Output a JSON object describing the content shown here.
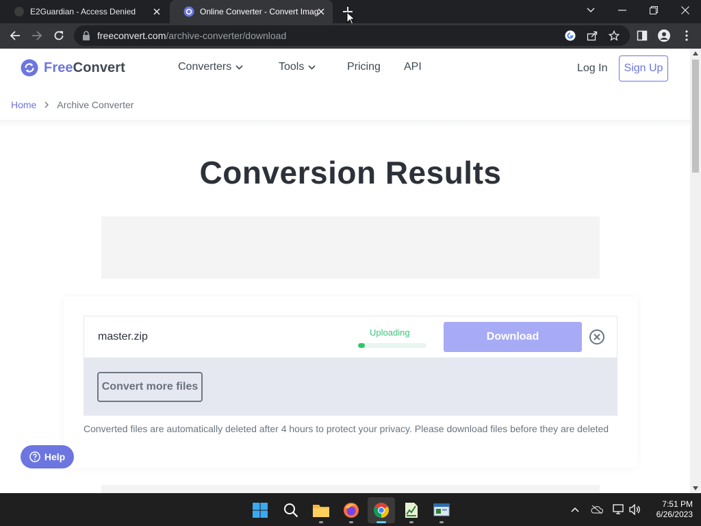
{
  "browser": {
    "tabs": [
      {
        "title": "E2Guardian - Access Denied",
        "active": false
      },
      {
        "title": "Online Converter - Convert Imag",
        "active": true
      }
    ],
    "address_bar": {
      "host": "freeconvert.com",
      "path": "/archive-converter/download"
    }
  },
  "site": {
    "logo": {
      "part1": "Free",
      "part2": "Convert"
    },
    "nav": {
      "converters": "Converters",
      "tools": "Tools",
      "pricing": "Pricing",
      "api": "API"
    },
    "login": "Log In",
    "signup": "Sign Up",
    "breadcrumb": {
      "home": "Home",
      "current": "Archive Converter"
    },
    "colors": {
      "brand": "#6c75e0",
      "success": "#3ac57a",
      "download_disabled": "#a7aaf5"
    }
  },
  "main": {
    "title": "Conversion Results",
    "file": {
      "name": "master.zip",
      "status": "Uploading",
      "progress_fraction": 0.1,
      "download_label": "Download"
    },
    "convert_more_label": "Convert more files",
    "note": "Converted files are automatically deleted after 4 hours to protect your privacy. Please download files before they are deleted",
    "help_label": "Help"
  },
  "taskbar": {
    "apps": [
      "start-icon",
      "search-icon",
      "file-explorer-icon",
      "firefox-icon",
      "chrome-icon",
      "spreadsheet-app-icon",
      "terminal-app-icon"
    ],
    "time": "7:51 PM",
    "date": "6/26/2023"
  }
}
